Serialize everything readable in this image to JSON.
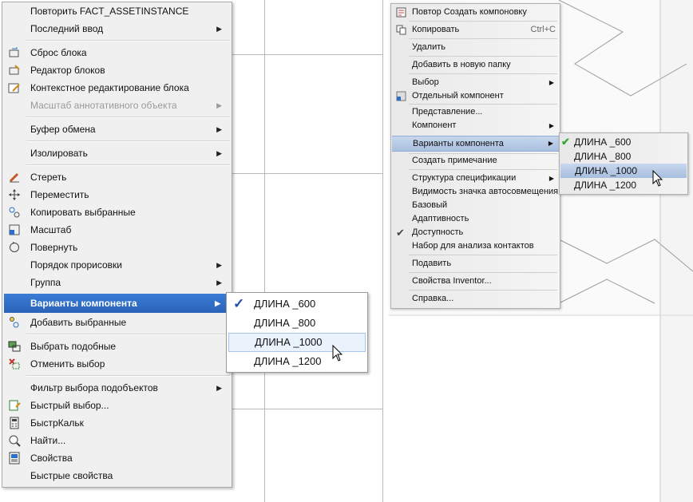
{
  "left_menu": {
    "items": [
      {
        "label": "Повторить FACT_ASSETINSTANCE",
        "arrow": false
      },
      {
        "label": "Последний ввод",
        "arrow": true
      },
      {
        "label": "Сброс блока",
        "arrow": false,
        "icon": "block-reset-icon"
      },
      {
        "label": "Редактор блоков",
        "arrow": false,
        "icon": "block-editor-icon"
      },
      {
        "label": "Контекстное редактирование блока",
        "arrow": false,
        "icon": "block-edit-context-icon"
      },
      {
        "label": "Масштаб аннотативного объекта",
        "arrow": true,
        "disabled": true
      },
      {
        "label": "Буфер обмена",
        "arrow": true
      },
      {
        "label": "Изолировать",
        "arrow": true
      },
      {
        "label": "Стереть",
        "arrow": false,
        "icon": "eraser-icon"
      },
      {
        "label": "Переместить",
        "arrow": false,
        "icon": "move-icon"
      },
      {
        "label": "Копировать выбранные",
        "arrow": false,
        "icon": "copy-selection-icon"
      },
      {
        "label": "Масштаб",
        "arrow": false,
        "icon": "scale-icon"
      },
      {
        "label": "Повернуть",
        "arrow": false,
        "icon": "rotate-icon"
      },
      {
        "label": "Порядок прорисовки",
        "arrow": true
      },
      {
        "label": "Группа",
        "arrow": true
      },
      {
        "label": "Варианты компонента",
        "arrow": true,
        "highlighted": true
      },
      {
        "label": "Добавить выбранные",
        "arrow": false,
        "icon": "add-selected-icon"
      },
      {
        "label": "Выбрать подобные",
        "arrow": false,
        "icon": "select-similar-icon"
      },
      {
        "label": "Отменить выбор",
        "arrow": false,
        "icon": "deselect-icon"
      },
      {
        "label": "Фильтр выбора подобъектов",
        "arrow": true
      },
      {
        "label": "Быстрый выбор...",
        "arrow": false,
        "icon": "quick-select-icon"
      },
      {
        "label": "БыстрКальк",
        "arrow": false,
        "icon": "calculator-icon"
      },
      {
        "label": "Найти...",
        "arrow": false,
        "icon": "find-icon"
      },
      {
        "label": "Свойства",
        "arrow": false,
        "icon": "properties-icon"
      },
      {
        "label": "Быстрые свойства",
        "arrow": false
      }
    ],
    "submenu": [
      {
        "label": "ДЛИНА _600",
        "checked": true
      },
      {
        "label": "ДЛИНА _800"
      },
      {
        "label": "ДЛИНА _1000",
        "selected": true
      },
      {
        "label": "ДЛИНА _1200"
      }
    ]
  },
  "right_menu": {
    "items": [
      {
        "label": "Повтор Создать компоновку",
        "icon": "repeat-layout-icon"
      },
      {
        "label": "Копировать",
        "icon": "copy-icon",
        "shortcut": "Ctrl+C"
      },
      {
        "label": "Удалить"
      },
      {
        "label": "Добавить в новую папку"
      },
      {
        "label": "Выбор",
        "arrow": true
      },
      {
        "label": "Отдельный компонент",
        "icon": "component-icon"
      },
      {
        "label": "Представление..."
      },
      {
        "label": "Компонент",
        "arrow": true
      },
      {
        "label": "Варианты компонента",
        "arrow": true,
        "highlighted": true
      },
      {
        "label": "Создать примечание"
      },
      {
        "label": "Структура спецификации",
        "arrow": true
      },
      {
        "label": "Видимость значка автосовмещения"
      },
      {
        "label": "Базовый"
      },
      {
        "label": "Адаптивность"
      },
      {
        "label": "Доступность",
        "checked": true
      },
      {
        "label": "Набор для анализа контактов"
      },
      {
        "label": "Подавить"
      },
      {
        "label": "Свойства Inventor..."
      },
      {
        "label": "Справка..."
      }
    ],
    "submenu": [
      {
        "label": "ДЛИНА _600",
        "checked": true
      },
      {
        "label": "ДЛИНА _800"
      },
      {
        "label": "ДЛИНА _1000",
        "selected": true
      },
      {
        "label": "ДЛИНА _1200"
      }
    ]
  },
  "colors": {
    "highlight_blue": "#2a64b8",
    "check_blue": "#1f4fb0",
    "check_green": "#3aa63a"
  }
}
